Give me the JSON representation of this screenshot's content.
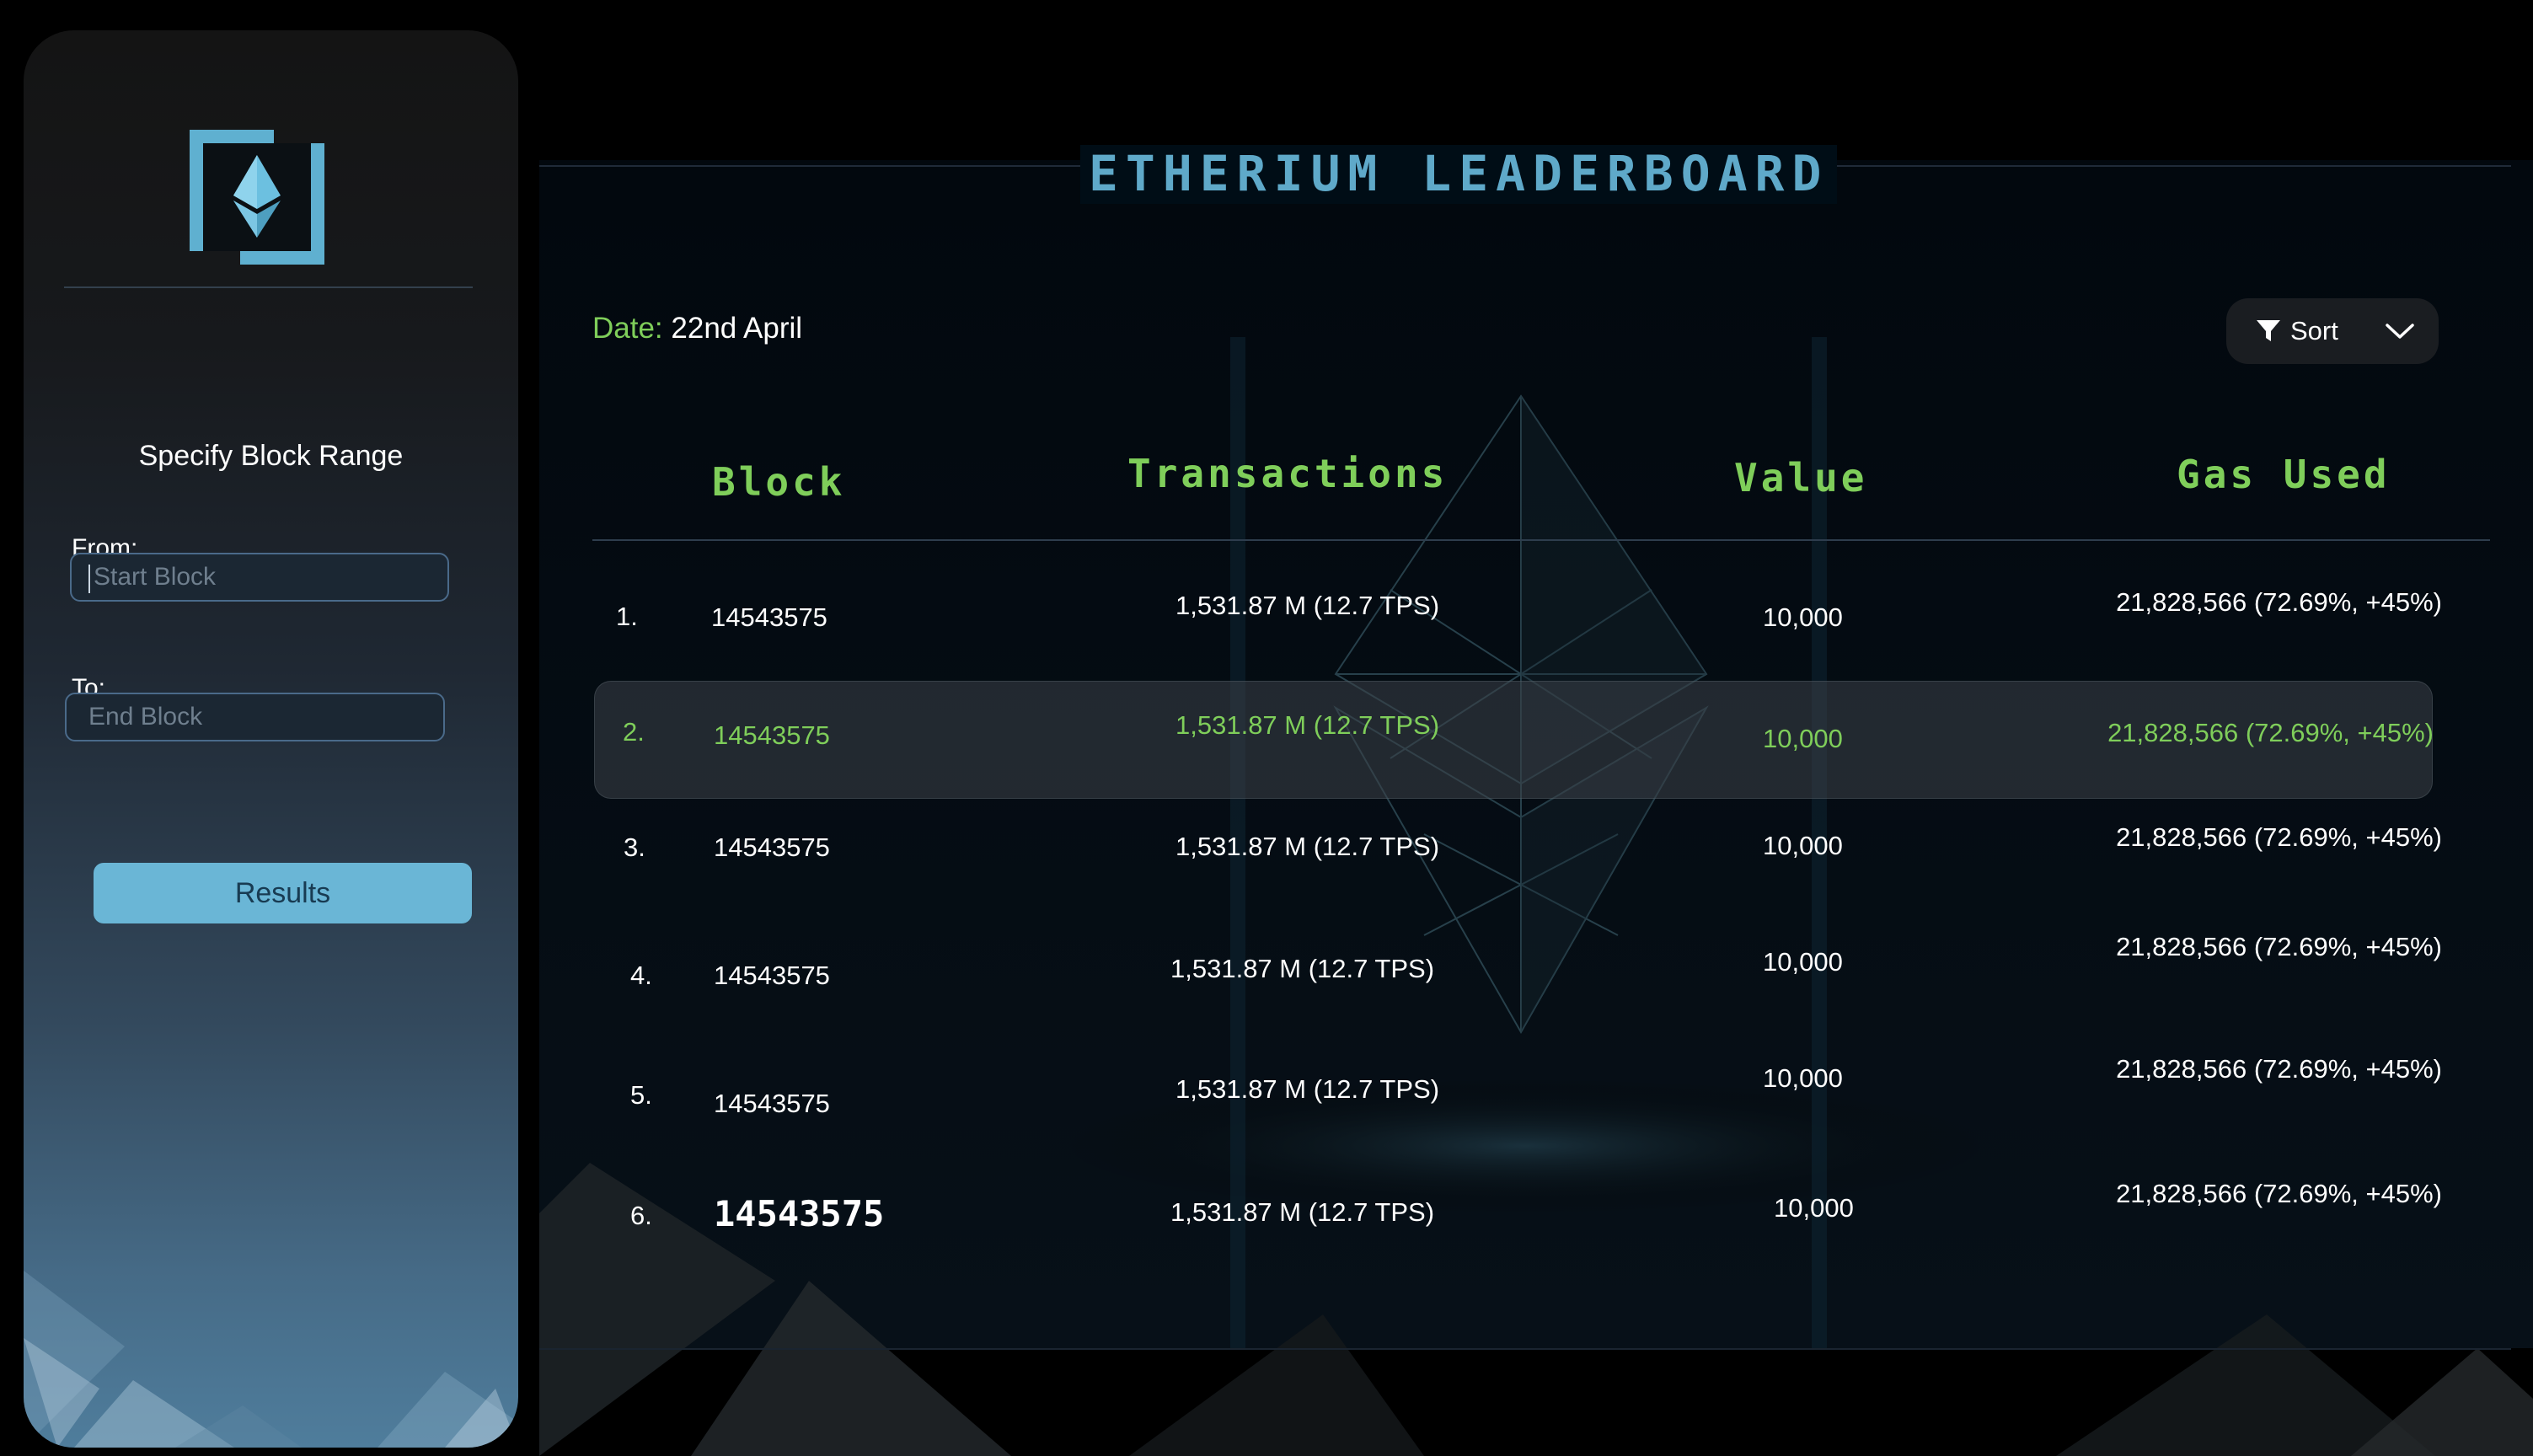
{
  "sidebar": {
    "heading": "Specify Block Range",
    "from_label": "From:",
    "from_placeholder": "Start Block",
    "to_label": "To:",
    "to_placeholder": "End Block",
    "results_label": "Results",
    "logo_icon": "ethereum-logo-icon"
  },
  "header": {
    "title": "ETHERIUM LEADERBOARD",
    "date_label": "Date:",
    "date_value": "22nd April",
    "sort_label": "Sort"
  },
  "table": {
    "columns": [
      "Block",
      "Transactions",
      "Value",
      "Gas Used"
    ],
    "highlighted_row": 2,
    "rows": [
      {
        "rank": "1.",
        "block": "14543575",
        "transactions": "1,531.87 M (12.7 TPS)",
        "value": "10,000",
        "gas": "21,828,566 (72.69%, +45%)"
      },
      {
        "rank": "2.",
        "block": "14543575",
        "transactions": "1,531.87 M (12.7 TPS)",
        "value": "10,000",
        "gas": "21,828,566 (72.69%, +45%)"
      },
      {
        "rank": "3.",
        "block": "14543575",
        "transactions": "1,531.87 M (12.7 TPS)",
        "value": "10,000",
        "gas": "21,828,566 (72.69%, +45%)"
      },
      {
        "rank": "4.",
        "block": "14543575",
        "transactions": "1,531.87 M (12.7 TPS)",
        "value": "10,000",
        "gas": "21,828,566 (72.69%, +45%)"
      },
      {
        "rank": "5.",
        "block": "14543575",
        "transactions": "1,531.87 M (12.7 TPS)",
        "value": "10,000",
        "gas": "21,828,566 (72.69%, +45%)"
      },
      {
        "rank": "6.",
        "block": "14543575",
        "transactions": "1,531.87 M (12.7 TPS)",
        "value": "10,000",
        "gas": "21,828,566 (72.69%, +45%)"
      }
    ]
  },
  "colors": {
    "accent_green": "#7fce5a",
    "title_blue": "#5fa9c9",
    "button_blue": "#6ab6d6"
  }
}
